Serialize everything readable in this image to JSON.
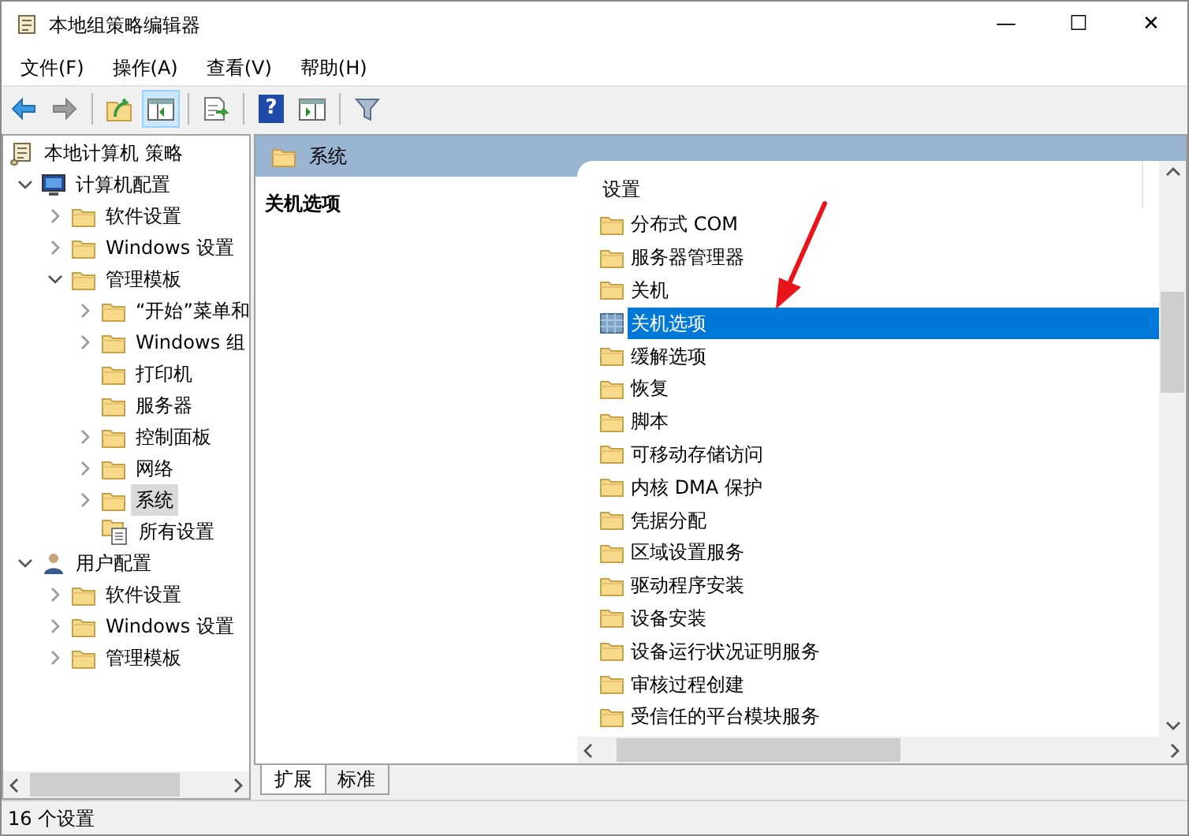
{
  "window": {
    "title": "本地组策略编辑器",
    "controls": [
      "—",
      "☐",
      "✕"
    ]
  },
  "menu": [
    "文件(F)",
    "操作(A)",
    "查看(V)",
    "帮助(H)"
  ],
  "toolbar": [
    {
      "kind": "back",
      "disabled": false,
      "pressed": false
    },
    {
      "kind": "forward",
      "disabled": true,
      "pressed": false
    },
    {
      "kind": "up",
      "disabled": false,
      "pressed": false
    },
    {
      "kind": "tree",
      "disabled": false,
      "pressed": true
    },
    {
      "kind": "export",
      "disabled": false,
      "pressed": false
    },
    {
      "kind": "help",
      "glyph": "?",
      "disabled": false,
      "pressed": false
    },
    {
      "kind": "pane",
      "disabled": false,
      "pressed": false
    },
    {
      "kind": "filter",
      "disabled": false,
      "pressed": false
    }
  ],
  "tree": [
    {
      "label": "本地计算机 策略",
      "kind": "policy",
      "selected": false,
      "children": [
        {
          "label": "计算机配置",
          "kind": "computer",
          "expanded": true,
          "selected": false,
          "children": [
            {
              "label": "软件设置",
              "kind": "folder",
              "expanded": false,
              "selected": false
            },
            {
              "label": "Windows 设置",
              "kind": "folder",
              "expanded": false,
              "selected": false
            },
            {
              "label": "管理模板",
              "kind": "folder",
              "expanded": true,
              "selected": false,
              "children": [
                {
                  "label": "“开始”菜单和",
                  "kind": "folder",
                  "expanded": false,
                  "selected": false
                },
                {
                  "label": "Windows 组",
                  "kind": "folder",
                  "expanded": false,
                  "selected": false
                },
                {
                  "label": "打印机",
                  "kind": "folder",
                  "selected": false
                },
                {
                  "label": "服务器",
                  "kind": "folder",
                  "selected": false
                },
                {
                  "label": "控制面板",
                  "kind": "folder",
                  "expanded": false,
                  "selected": false
                },
                {
                  "label": "网络",
                  "kind": "folder",
                  "expanded": false,
                  "selected": false
                },
                {
                  "label": "系统",
                  "kind": "folder",
                  "expanded": false,
                  "selected": true
                },
                {
                  "label": "所有设置",
                  "kind": "settings",
                  "selected": false
                }
              ]
            }
          ]
        },
        {
          "label": "用户配置",
          "kind": "user",
          "expanded": true,
          "selected": false,
          "children": [
            {
              "label": "软件设置",
              "kind": "folder",
              "expanded": false,
              "selected": false
            },
            {
              "label": "Windows 设置",
              "kind": "folder",
              "expanded": false,
              "selected": false
            },
            {
              "label": "管理模板",
              "kind": "folder",
              "expanded": false,
              "selected": false
            }
          ]
        }
      ]
    }
  ],
  "details": {
    "header": "系统",
    "description_title": "关机选项",
    "column": "设置",
    "items": [
      {
        "label": "分布式 COM",
        "kind": "folder",
        "selected": false
      },
      {
        "label": "服务器管理器",
        "kind": "folder",
        "selected": false
      },
      {
        "label": "关机",
        "kind": "folder",
        "selected": false
      },
      {
        "label": "关机选项",
        "kind": "setting",
        "selected": true
      },
      {
        "label": "缓解选项",
        "kind": "folder",
        "selected": false
      },
      {
        "label": "恢复",
        "kind": "folder",
        "selected": false
      },
      {
        "label": "脚本",
        "kind": "folder",
        "selected": false
      },
      {
        "label": "可移动存储访问",
        "kind": "folder",
        "selected": false
      },
      {
        "label": "内核 DMA 保护",
        "kind": "folder",
        "selected": false
      },
      {
        "label": "凭据分配",
        "kind": "folder",
        "selected": false
      },
      {
        "label": "区域设置服务",
        "kind": "folder",
        "selected": false
      },
      {
        "label": "驱动程序安装",
        "kind": "folder",
        "selected": false
      },
      {
        "label": "设备安装",
        "kind": "folder",
        "selected": false
      },
      {
        "label": "设备运行状况证明服务",
        "kind": "folder",
        "selected": false
      },
      {
        "label": "审核过程创建",
        "kind": "folder",
        "selected": false
      },
      {
        "label": "受信任的平台模块服务",
        "kind": "folder",
        "selected": false
      }
    ],
    "tabs": [
      {
        "label": "扩展",
        "selected": true
      },
      {
        "label": "标准",
        "selected": false
      }
    ]
  },
  "status_bar": "16 个设置"
}
